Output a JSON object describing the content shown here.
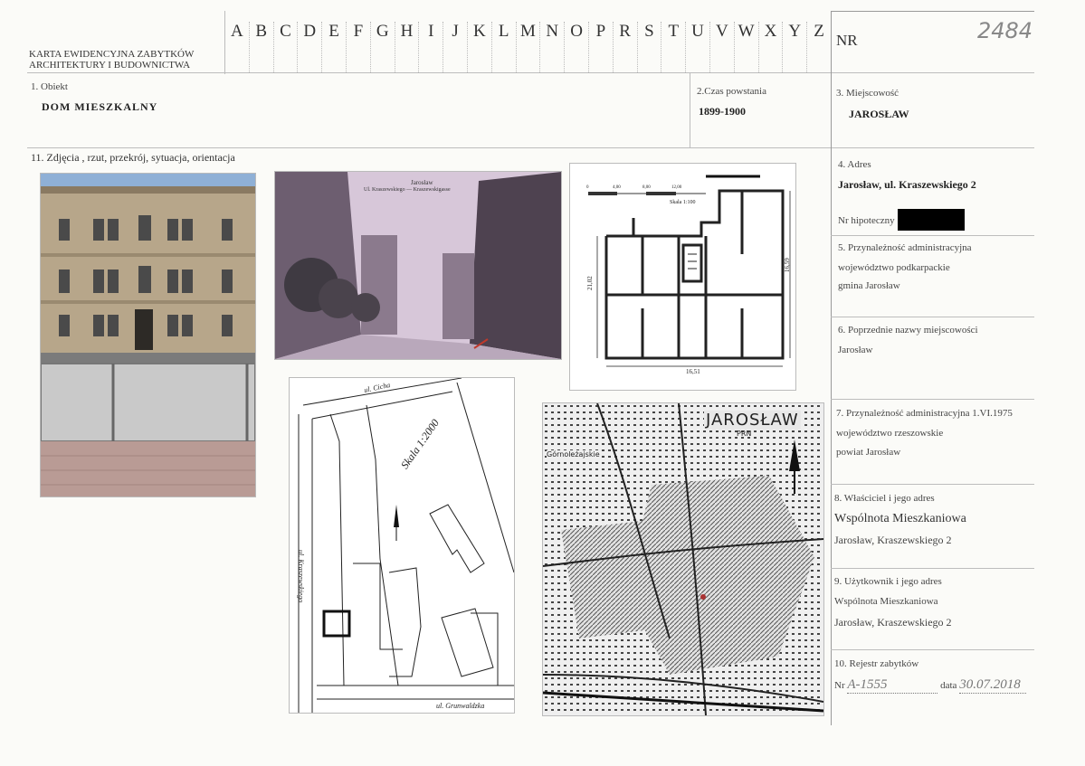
{
  "header": {
    "card_title_line1": "KARTA EWIDENCYJNA ZABYTKÓW",
    "card_title_line2": "ARCHITEKTURY I BUDOWNICTWA",
    "letters": [
      "A",
      "B",
      "C",
      "D",
      "E",
      "F",
      "G",
      "H",
      "I",
      "J",
      "K",
      "L",
      "M",
      "N",
      "O",
      "P",
      "R",
      "S",
      "T",
      "U",
      "V",
      "W",
      "X",
      "Y",
      "Z"
    ],
    "nr_label": "NR",
    "nr_value": "2484"
  },
  "object": {
    "label": "1. Obiekt",
    "value": "DOM MIESZKALNY"
  },
  "creation": {
    "label": "2.Czas powstania",
    "value": "1899-1900"
  },
  "locality": {
    "label": "3. Miejscowość",
    "value": "JAROSŁAW"
  },
  "address": {
    "label": "4. Adres",
    "value": "Jarosław, ul. Kraszewskiego 2",
    "mortgage_label": "Nr hipoteczny"
  },
  "admin_current": {
    "label": "5. Przynależność administracyjna",
    "line1": "województwo  podkarpackie",
    "line2": "gmina  Jarosław"
  },
  "previous_names": {
    "label": "6. Poprzednie nazwy miejscowości",
    "value": "Jarosław"
  },
  "admin_1975": {
    "label": "7. Przynależność administracyjna 1.VI.1975",
    "line1": "województwo  rzeszowskie",
    "line2": "powiat   Jarosław"
  },
  "owner": {
    "label": "8. Właściciel i jego adres",
    "line1": "Wspólnota Mieszkaniowa",
    "line2": "Jarosław, Kraszewskiego 2"
  },
  "user": {
    "label": "9. Użytkownik i jego adres",
    "line1": "Wspólnota  Mieszkaniowa",
    "line2": "Jarosław, Kraszewskiego 2"
  },
  "register": {
    "label": "10. Rejestr zabytków",
    "nr_prefix": "Nr",
    "nr_value": "A-1555",
    "date_label": "data",
    "date_value": "30.07.2018"
  },
  "photos_section": {
    "label": "11. Zdjęcia , rzut, przekrój, sytuacja, orientacja"
  },
  "postcard": {
    "title": "Jarosław",
    "subtitle": "Ul. Kraszewskiego — Kraszewskigasse"
  },
  "floorplan": {
    "scale_label": "Skala 1:100",
    "width_label": "16,51",
    "depth_label": "21,02",
    "side_label": "16,59",
    "bar_0": "0",
    "bar_1": "4,00",
    "bar_2": "8,00",
    "bar_3": "12,00"
  },
  "site_plan": {
    "street_top": "ul. Cicha",
    "street_left": "ul. Kraszewskiego",
    "street_bottom": "ul. Grunwaldzka",
    "scale": "Skala 1:2000"
  },
  "town_map": {
    "title": "JAROSŁAW",
    "subtitle": "PRN",
    "district": "Górnoleżajskie"
  },
  "colors": {
    "line": "#bdbdbd",
    "redaction": "#000000",
    "marker": "#a33"
  }
}
